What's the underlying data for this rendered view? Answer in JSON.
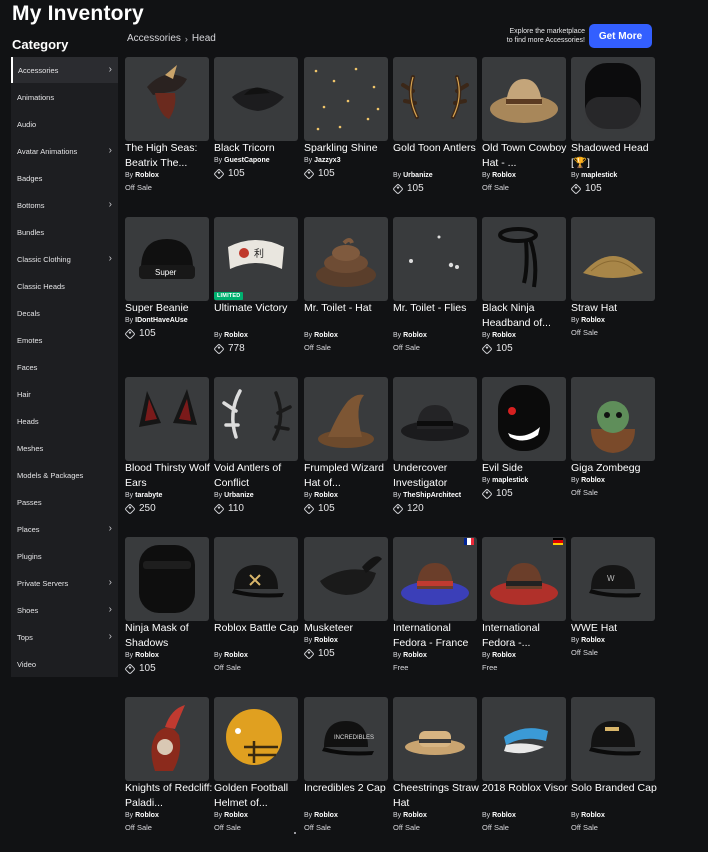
{
  "page": {
    "title": "My Inventory"
  },
  "sidebar": {
    "title": "Category",
    "items": [
      {
        "label": "Accessories",
        "chevron": true,
        "active": true
      },
      {
        "label": "Animations",
        "chevron": false
      },
      {
        "label": "Audio",
        "chevron": false
      },
      {
        "label": "Avatar Animations",
        "chevron": true
      },
      {
        "label": "Badges",
        "chevron": false
      },
      {
        "label": "Bottoms",
        "chevron": true
      },
      {
        "label": "Bundles",
        "chevron": false
      },
      {
        "label": "Classic Clothing",
        "chevron": true
      },
      {
        "label": "Classic Heads",
        "chevron": false
      },
      {
        "label": "Decals",
        "chevron": false
      },
      {
        "label": "Emotes",
        "chevron": false
      },
      {
        "label": "Faces",
        "chevron": false
      },
      {
        "label": "Hair",
        "chevron": false
      },
      {
        "label": "Heads",
        "chevron": false
      },
      {
        "label": "Meshes",
        "chevron": false
      },
      {
        "label": "Models & Packages",
        "chevron": false
      },
      {
        "label": "Passes",
        "chevron": false
      },
      {
        "label": "Places",
        "chevron": true
      },
      {
        "label": "Plugins",
        "chevron": false
      },
      {
        "label": "Private Servers",
        "chevron": true
      },
      {
        "label": "Shoes",
        "chevron": true
      },
      {
        "label": "Tops",
        "chevron": true
      },
      {
        "label": "Video",
        "chevron": false
      }
    ],
    "chevron_glyph": "›"
  },
  "breadcrumb": {
    "items": [
      "Accessories",
      "Head"
    ],
    "separator": "›"
  },
  "promo": {
    "line1": "Explore the marketplace",
    "line2": "to find more Accessories!",
    "button": "Get More"
  },
  "labels": {
    "by": "By",
    "limited": "LIMITED"
  },
  "items": [
    {
      "name": "The High Seas: Beatrix The...",
      "creator": "Roblox",
      "price": "Off Sale",
      "icon": "pirate-hat-icon"
    },
    {
      "name": "Black Tricorn",
      "creator": "GuestCapone",
      "price": "105",
      "icon": "tricorn-hat-icon"
    },
    {
      "name": "Sparkling Shine",
      "creator": "Jazzyx3",
      "price": "105",
      "icon": "sparkles-icon"
    },
    {
      "name": "Gold Toon Antlers",
      "creator": "Urbanize",
      "price": "105",
      "icon": "antlers-icon"
    },
    {
      "name": "Old Town Cowboy Hat - ...",
      "creator": "Roblox",
      "price": "Off Sale",
      "icon": "cowboy-hat-icon"
    },
    {
      "name": "Shadowed Head [🏆]",
      "creator": "maplestick",
      "price": "105",
      "icon": "shadow-head-icon"
    },
    {
      "name": "Super Beanie",
      "creator": "IDontHaveAUse",
      "price": "105",
      "icon": "beanie-icon"
    },
    {
      "name": "Ultimate Victory",
      "creator": "Roblox",
      "price": "778",
      "icon": "headband-icon",
      "limited": true
    },
    {
      "name": "Mr. Toilet - Hat",
      "creator": "Roblox",
      "price": "Off Sale",
      "icon": "swirl-hat-icon"
    },
    {
      "name": "Mr. Toilet - Flies",
      "creator": "Roblox",
      "price": "Off Sale",
      "icon": "flies-icon"
    },
    {
      "name": "Black Ninja Headband of...",
      "creator": "Roblox",
      "price": "105",
      "icon": "ninja-headband-icon"
    },
    {
      "name": "Straw Hat",
      "creator": "Roblox",
      "price": "Off Sale",
      "icon": "straw-hat-icon"
    },
    {
      "name": "Blood Thirsty Wolf Ears",
      "creator": "tarabyte",
      "price": "250",
      "icon": "wolf-ears-icon"
    },
    {
      "name": "Void Antlers of Conflict",
      "creator": "Urbanize",
      "price": "110",
      "icon": "void-antlers-icon"
    },
    {
      "name": "Frumpled Wizard Hat of...",
      "creator": "Roblox",
      "price": "105",
      "icon": "wizard-hat-icon"
    },
    {
      "name": "Undercover Investigator",
      "creator": "TheShipArchitect",
      "price": "120",
      "icon": "fedora-icon"
    },
    {
      "name": "Evil Side",
      "creator": "maplestick",
      "price": "105",
      "icon": "evil-mask-icon"
    },
    {
      "name": "Giga Zombegg",
      "creator": "Roblox",
      "price": "Off Sale",
      "icon": "zombie-egg-icon"
    },
    {
      "name": "Ninja Mask of Shadows",
      "creator": "Roblox",
      "price": "105",
      "icon": "ninja-mask-icon"
    },
    {
      "name": "Roblox Battle Cap",
      "creator": "Roblox",
      "price": "Off Sale",
      "icon": "battle-cap-icon"
    },
    {
      "name": "Musketeer",
      "creator": "Roblox",
      "price": "105",
      "icon": "musketeer-hat-icon"
    },
    {
      "name": "International Fedora - France",
      "creator": "Roblox",
      "price": "Free",
      "icon": "fedora-france-icon",
      "flag": [
        "#002395",
        "#ffffff",
        "#ed2939"
      ]
    },
    {
      "name": "International Fedora -...",
      "creator": "Roblox",
      "price": "Free",
      "icon": "fedora-germany-icon",
      "flag": [
        "#000000",
        "#dd0000",
        "#ffce00"
      ]
    },
    {
      "name": "WWE Hat",
      "creator": "Roblox",
      "price": "Off Sale",
      "icon": "wwe-cap-icon"
    },
    {
      "name": "Knights of Redcliff: Paladi...",
      "creator": "Roblox",
      "price": "Off Sale",
      "icon": "knight-helmet-icon"
    },
    {
      "name": "Golden Football Helmet of...",
      "creator": "Roblox",
      "price": "Off Sale",
      "icon": "football-helmet-icon"
    },
    {
      "name": "Incredibles 2 Cap",
      "creator": "Roblox",
      "price": "Off Sale",
      "icon": "incredibles-cap-icon"
    },
    {
      "name": "Cheestrings Straw Hat",
      "creator": "Roblox",
      "price": "Off Sale",
      "icon": "boater-hat-icon"
    },
    {
      "name": "2018 Roblox Visor",
      "creator": "Roblox",
      "price": "Off Sale",
      "icon": "visor-icon"
    },
    {
      "name": "Solo Branded Cap",
      "creator": "Roblox",
      "price": "Off Sale",
      "icon": "solo-cap-icon"
    }
  ],
  "colors": {
    "accent": "#335fff",
    "background": "#111214",
    "sidebar": "#1d1e21",
    "card": "#393b3d",
    "limited": "#00b06f"
  }
}
